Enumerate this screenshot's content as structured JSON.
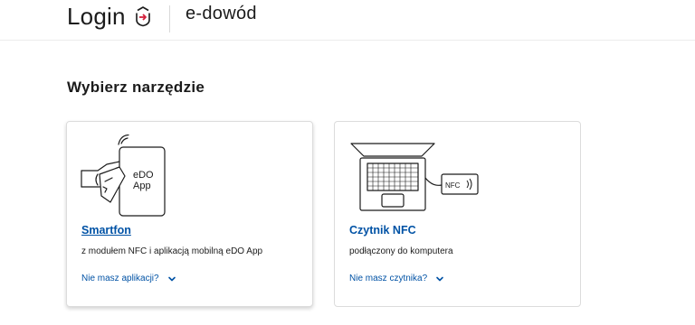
{
  "header": {
    "title": "Login",
    "subtitle": "e-dowód"
  },
  "main": {
    "heading": "Wybierz narzędzie",
    "cards": [
      {
        "title": "Smartfon",
        "description": "z modułem NFC i aplikacją mobilną eDO App",
        "link": "Nie masz aplikacji?",
        "illustration_text": [
          "eDO",
          "App"
        ]
      },
      {
        "title": "Czytnik NFC",
        "description": "podłączony do komputera",
        "link": "Nie masz czytnika?",
        "illustration_text": [
          "NFC"
        ]
      }
    ]
  },
  "colors": {
    "accent": "#0052a5",
    "brand_icon": "#d4213d",
    "text": "#1b1b1b"
  },
  "icons": [
    "login-icon",
    "chevron-down-icon",
    "smartphone-illustration",
    "laptop-nfc-illustration"
  ]
}
